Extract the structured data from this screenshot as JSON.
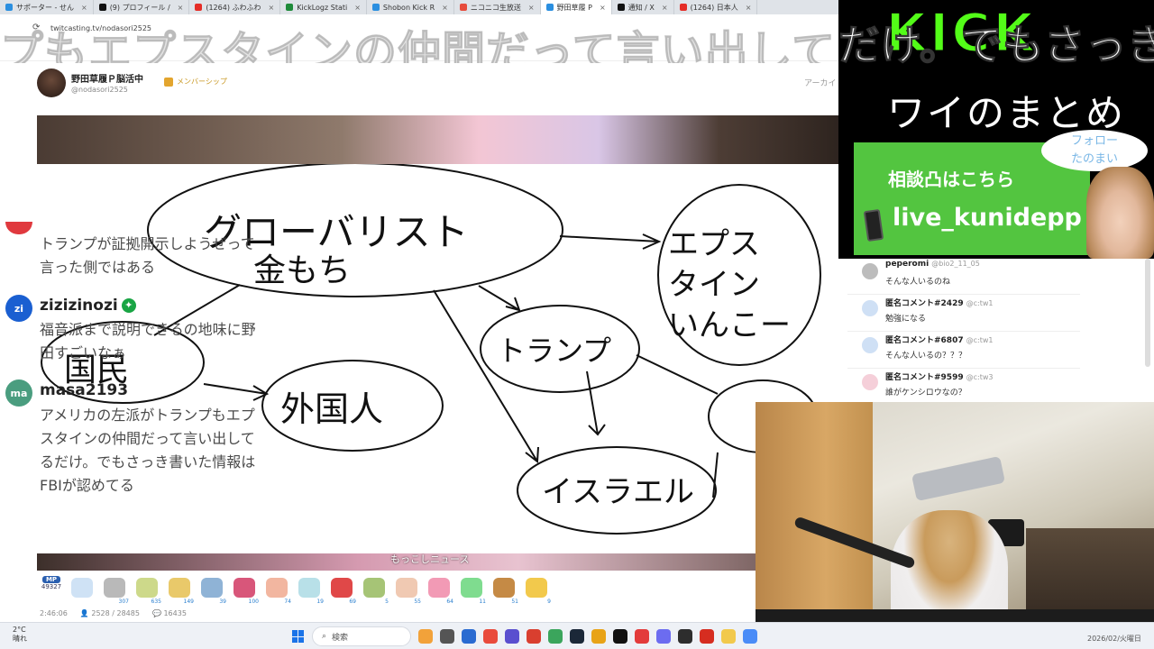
{
  "browser": {
    "tabs": [
      {
        "label": "サポーター - せん",
        "color": "#2b8fe0"
      },
      {
        "label": "(9) プロフィール /",
        "color": "#111111"
      },
      {
        "label": "(1264) ふわふわ",
        "color": "#e52d27"
      },
      {
        "label": "KickLogz Stati",
        "color": "#1f8b3a"
      },
      {
        "label": "Shobon Kick R",
        "color": "#2b8fe0"
      },
      {
        "label": "ニコニコ生放送",
        "color": "#e74c3c"
      },
      {
        "label": "野田草履 P",
        "color": "#2b8fe0"
      },
      {
        "label": "通知 / X",
        "color": "#111111"
      },
      {
        "label": "(1264) 日本人",
        "color": "#e52d27"
      }
    ],
    "url": "twitcasting.tv/nodasori2525"
  },
  "scroll_text": "プもエプスタインの仲間だって言い出してるだけ。でもさっき書",
  "channel": {
    "name": "野田草履Ｐ脳活中",
    "handle": "@nodasori2525",
    "membership_label": "メンバーシップ",
    "archive_label": "アーカイ"
  },
  "chat_overlay": [
    {
      "user": "",
      "avatar_text": "",
      "avatar_color": "#e0393e",
      "text": "トランプが証拠開示しようぜって言った側ではある"
    },
    {
      "user": "zizizinozi",
      "avatar_text": "zi",
      "avatar_color": "#1a5fd1",
      "text": "福音派まで説明できるの地味に野田すごいなぁ"
    },
    {
      "user": "masa2193",
      "avatar_text": "ma",
      "avatar_color": "#4a9d7f",
      "text": "アメリカの左派がトランプもエプスタインの仲間だって言い出してるだけ。でもさっき書いた情報はFBIが認めてる"
    }
  ],
  "board_words": {
    "globalist": "グローバリスト",
    "rich": "金もち",
    "epstein_1": "エプス",
    "epstein_2": "タイン",
    "epstein_3": "いんこー",
    "trump": "トランプ",
    "foreigner": "外国人",
    "israel": "イスラエル",
    "citizens": "国民"
  },
  "stream_subtitle": "もっこしニュース",
  "gifts": {
    "mp_label": "MP",
    "mp_value": "49327",
    "items": [
      {
        "count": "",
        "color": "#cfe2f5"
      },
      {
        "count": "307",
        "color": "#b9b9b9"
      },
      {
        "count": "635",
        "color": "#cdd98a"
      },
      {
        "count": "149",
        "color": "#e9c96a"
      },
      {
        "count": "39",
        "color": "#8fb3d6"
      },
      {
        "count": "100",
        "color": "#d8567a"
      },
      {
        "count": "74",
        "color": "#f2b6a0"
      },
      {
        "count": "19",
        "color": "#b8e0e8"
      },
      {
        "count": "69",
        "color": "#e04848"
      },
      {
        "count": "5",
        "color": "#a6c476"
      },
      {
        "count": "55",
        "color": "#f0c9b2"
      },
      {
        "count": "64",
        "color": "#f29ab5"
      },
      {
        "count": "11",
        "color": "#7fdc8f"
      },
      {
        "count": "51",
        "color": "#c58a45"
      },
      {
        "count": "9",
        "color": "#f2c94c"
      }
    ]
  },
  "stream_status": {
    "elapsed": "2:46:06",
    "viewers": "2528 / 28485",
    "comments": "16435"
  },
  "right_overlay": {
    "kick": "KICK",
    "scroll": "だけ。でもさっき書",
    "summary": "ワイのまとめ",
    "consult": "相談凸はこちら",
    "live_id": "live_kunidepp",
    "follow": "フォロー\nたのまい"
  },
  "comments": [
    {
      "name": "peperomi",
      "id": "@bio2_11_05",
      "text": "そんな人いるのね",
      "avatar": "#bcbcbc"
    },
    {
      "name": "匿名コメント#2429",
      "id": "@c:tw1",
      "text": "勉強になる",
      "avatar": "#cfe0f5"
    },
    {
      "name": "匿名コメント#6807",
      "id": "@c:tw1",
      "text": "そんな人いるの？？？",
      "avatar": "#cfe0f5"
    },
    {
      "name": "匿名コメント#9599",
      "id": "@c:tw3",
      "text": "誰がケンシロウなの？",
      "avatar": "#f5cfd9"
    }
  ],
  "taskbar": {
    "temp": "2°C",
    "weather": "晴れ",
    "search_placeholder": "検索",
    "date": "2026/02/火曜日",
    "icons": [
      "#f2a23a",
      "#555555",
      "#2a6bd1",
      "#e94b3c",
      "#5a4fcf",
      "#d93f2f",
      "#3ba55c",
      "#1b2838",
      "#e8a317",
      "#111111",
      "#e33b3b",
      "#6c6cf0",
      "#2d2d2d",
      "#d62d20",
      "#f2c94c",
      "#4a8cf7"
    ]
  }
}
